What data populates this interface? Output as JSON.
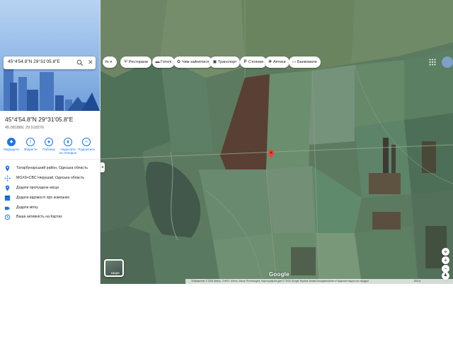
{
  "search": {
    "query": "45°4'54.8\"N 29°31'05.8\"E"
  },
  "place": {
    "title": "45°4'54.8\"N 29°31'05.8\"E",
    "subtitle": "45.081889, 29.518276"
  },
  "actions": [
    {
      "label": "Маршрути",
      "icon": "directions-icon"
    },
    {
      "label": "Зберегти",
      "icon": "bookmark-icon"
    },
    {
      "label": "Поблизу",
      "icon": "nearby-icon"
    },
    {
      "label": "Надіслати на телефон",
      "icon": "send-to-phone-icon"
    },
    {
      "label": "Поділитися",
      "icon": "share-icon"
    }
  ],
  "info_rows": [
    {
      "text": "Татарбунарський район, Одеська область",
      "icon": "location-icon"
    },
    {
      "text": "MGX9+CBC Нерушай, Одеська область",
      "icon": "plus-code-icon"
    },
    {
      "text": "Додати пропущене місце",
      "icon": "add-place-icon"
    },
    {
      "text": "Додати відомості про компанію",
      "icon": "add-business-icon"
    },
    {
      "text": "Додати мітку",
      "icon": "add-label-icon"
    },
    {
      "text": "Ваша активність на Картах",
      "icon": "history-icon"
    }
  ],
  "map": {
    "dropdown_label": "Ук",
    "chips": [
      {
        "label": "Ресторани",
        "icon": "restaurant-icon"
      },
      {
        "label": "Готелі",
        "icon": "hotel-icon"
      },
      {
        "label": "Чим зайнятися",
        "icon": "activities-icon"
      },
      {
        "label": "Транспорт",
        "icon": "transit-icon"
      },
      {
        "label": "Стоянки",
        "icon": "parking-icon"
      },
      {
        "label": "Аптеки",
        "icon": "pharmacy-icon"
      },
      {
        "label": "Банкомати",
        "icon": "atm-icon"
      }
    ],
    "layers_label": "Шари",
    "google_label": "Google",
    "attribution": "Зображення © 2024 Airbus, CNES / Airbus, Maxar Technologies, Картографічні дані © 2024 Google    Україна    Умови    Конфіденційність    Надіслати відгук про продукт",
    "scale_label": "500 м",
    "pin_color": "#ea4335",
    "accent_color": "#1a73e8"
  }
}
